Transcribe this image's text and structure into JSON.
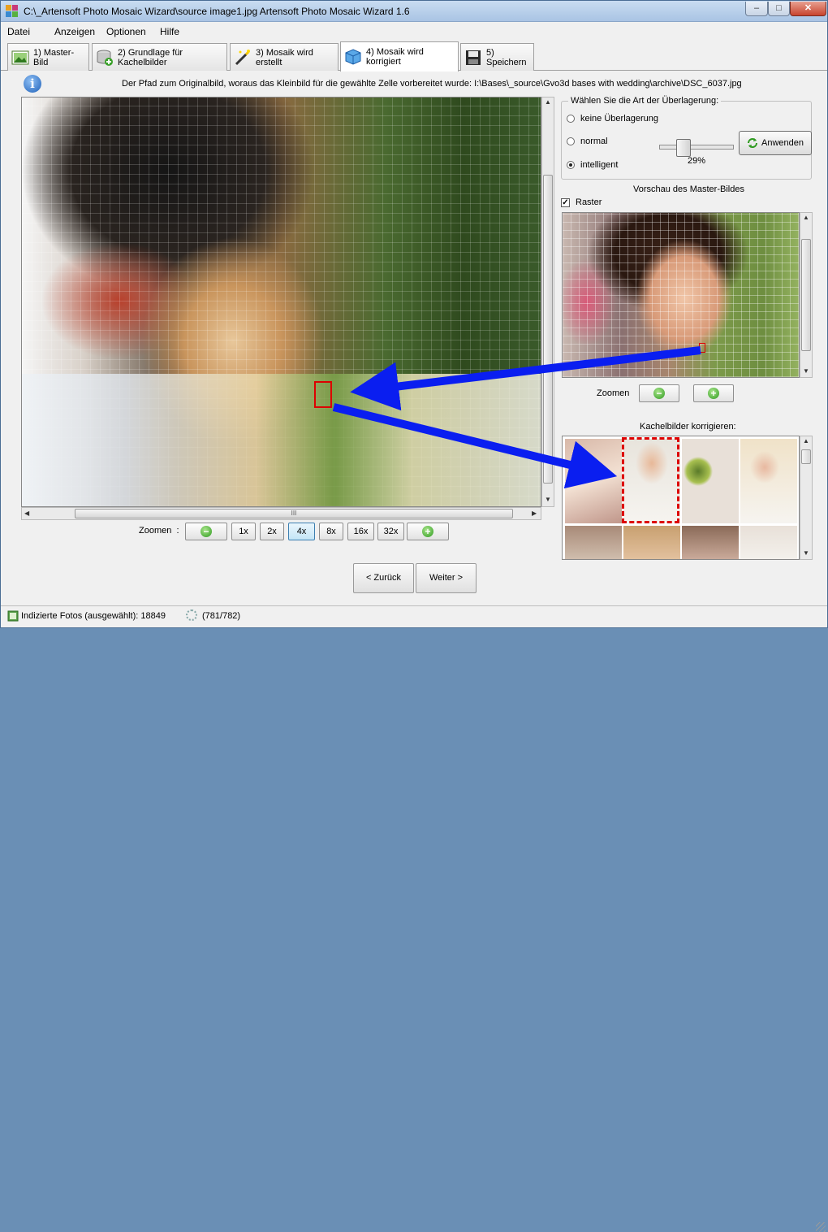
{
  "window": {
    "title": "C:\\_Artensoft Photo Mosaic Wizard\\source image1.jpg Artensoft Photo Mosaic Wizard 1.6",
    "min_glyph": "–",
    "max_glyph": "□",
    "close_glyph": "✕"
  },
  "menu": [
    "Datei",
    "Anzeigen",
    "Optionen",
    "Hilfe"
  ],
  "tabs": [
    {
      "label": "1) Master-Bild",
      "icon": "image-icon"
    },
    {
      "label": "2) Grundlage für Kachelbilder",
      "icon": "database-add-icon"
    },
    {
      "label": "3) Mosaik wird erstellt",
      "icon": "magic-wand-icon"
    },
    {
      "label": "4) Mosaik wird korrigiert",
      "icon": "cube-icon"
    },
    {
      "label": "5) Speichern",
      "icon": "floppy-disk-icon"
    }
  ],
  "active_tab": 3,
  "path_info": "Der Pfad zum Originalbild, woraus das Kleinbild für die gewählte Zelle vorbereitet wurde: I:\\Bases\\_source\\Gvo3d bases with wedding\\archive\\DSC_6037.jpg",
  "info_icon_glyph": "i",
  "zoom": {
    "label": "Zoomen",
    "separator": ":",
    "levels": [
      "1x",
      "2x",
      "4x",
      "8x",
      "16x",
      "32x"
    ],
    "selected": "4x",
    "minus_glyph": "−",
    "plus_glyph": "+"
  },
  "overlay": {
    "title": "Wählen Sie die Art der Überlagerung:",
    "options": [
      "keine Überlagerung",
      "normal",
      "intelligent"
    ],
    "selected": "intelligent",
    "slider_value_percent": 29,
    "slider_label": "29%",
    "apply_label": "Anwenden"
  },
  "preview": {
    "title": "Vorschau des Master-Bildes",
    "raster_label": "Raster",
    "raster_checked": true,
    "check_glyph": "✓",
    "zoom_label": "Zoomen"
  },
  "tiles": {
    "title": "Kachelbilder korrigieren:"
  },
  "nav": {
    "back_label": "< Zurück",
    "next_label": "Weiter >"
  },
  "status": {
    "indexed_label": "Indizierte Fotos (ausgewählt): 18849",
    "progress": "(781/782)"
  },
  "scroll": {
    "up": "▲",
    "down": "▼",
    "left": "◀",
    "right": "▶",
    "grip": "III"
  },
  "colors": {
    "arrow": "#0a1ef0",
    "selection": "#dd0000",
    "accent": "#3c7fb1"
  }
}
